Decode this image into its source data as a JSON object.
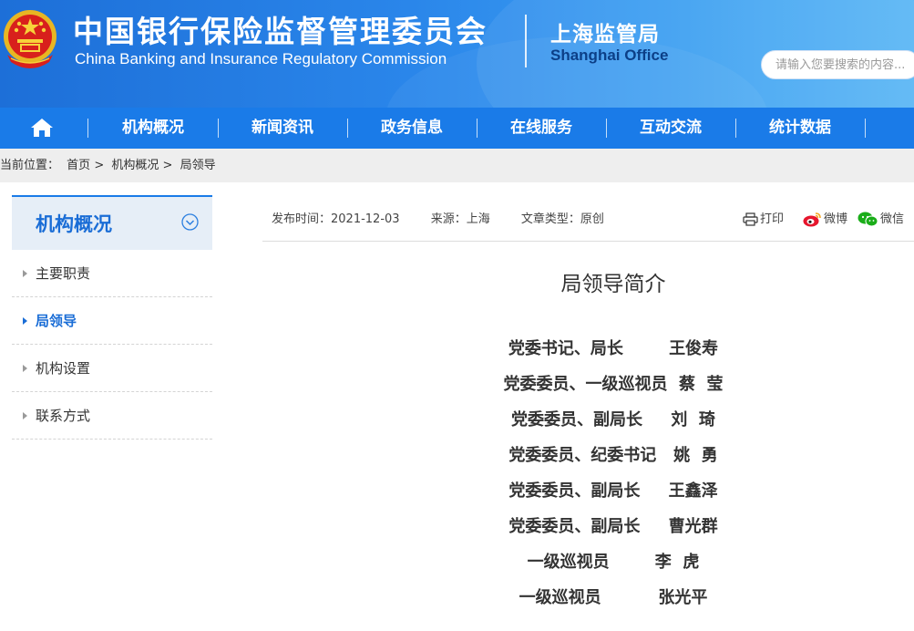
{
  "header": {
    "cn_title": "中国银行保险监督管理委员会",
    "en_title": "China Banking and Insurance Regulatory Commission",
    "office_cn": "上海监管局",
    "office_en": "Shanghai Office",
    "search_placeholder": "请输入您要搜索的内容..."
  },
  "nav": {
    "home_icon": "home-icon",
    "items": [
      "机构概况",
      "新闻资讯",
      "政务信息",
      "在线服务",
      "互动交流",
      "统计数据"
    ]
  },
  "breadcrumb": {
    "label": "当前位置：",
    "items": [
      "首页",
      "机构概况",
      "局领导"
    ],
    "separator": ">"
  },
  "sidebar": {
    "title": "机构概况",
    "items": [
      "主要职责",
      "局领导",
      "机构设置",
      "联系方式"
    ],
    "active": "局领导"
  },
  "meta": {
    "publish_time": "发布时间：2021-12-03",
    "source": "来源：上海",
    "article_type": "文章类型：原创",
    "print": "打印",
    "weibo": "微博",
    "wechat": "微信"
  },
  "article": {
    "title": "局领导简介",
    "leaders": [
      {
        "position": "党委书记、局长",
        "name": "王俊寿"
      },
      {
        "position": "党委委员、一级巡视员",
        "name": "蔡  莹"
      },
      {
        "position": "党委委员、副局长",
        "name": "刘  琦"
      },
      {
        "position": "党委委员、纪委书记",
        "name": "姚  勇"
      },
      {
        "position": "党委委员、副局长",
        "name": "王鑫泽"
      },
      {
        "position": "党委委员、副局长",
        "name": "曹光群"
      },
      {
        "position": "一级巡视员",
        "name": "李  虎"
      },
      {
        "position": "一级巡视员",
        "name": "张光平"
      }
    ]
  },
  "colors": {
    "header_blue": "#1d6fd8",
    "nav_blue": "#1a7be8",
    "accent": "#1a6dd6",
    "office_en": "#0c3f87"
  }
}
